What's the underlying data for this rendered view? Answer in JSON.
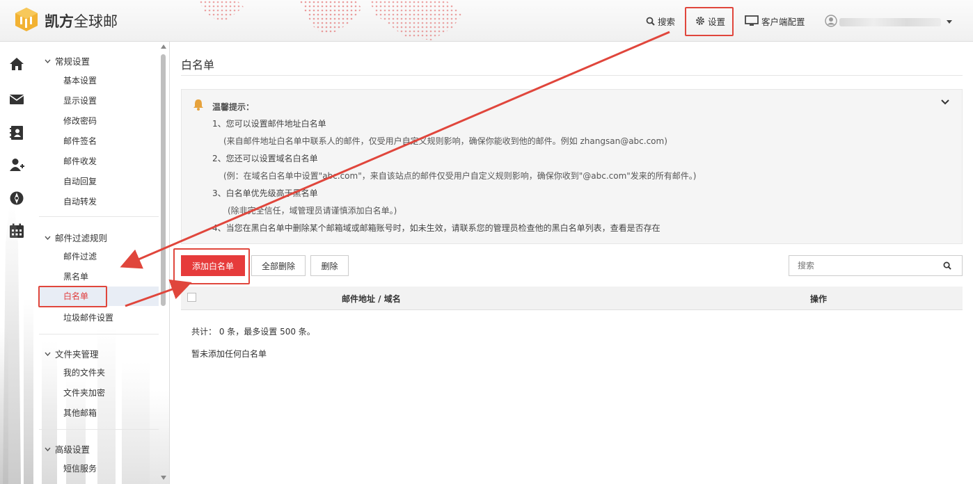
{
  "app": {
    "brand_bold": "凯方",
    "brand_rest": "全球邮"
  },
  "header": {
    "search_label": "搜索",
    "settings_label": "设置",
    "client_config_label": "客户端配置"
  },
  "sidebar": {
    "groups": [
      {
        "label": "常规设置",
        "items": [
          "基本设置",
          "显示设置",
          "修改密码",
          "邮件签名",
          "邮件收发",
          "自动回复",
          "自动转发"
        ]
      },
      {
        "label": "邮件过滤规则",
        "items": [
          "邮件过滤",
          "黑名单",
          "白名单",
          "垃圾邮件设置"
        ]
      },
      {
        "label": "文件夹管理",
        "items": [
          "我的文件夹",
          "文件夹加密",
          "其他邮箱"
        ]
      },
      {
        "label": "高级设置",
        "items": [
          "短信服务"
        ]
      }
    ],
    "active_item": "白名单"
  },
  "main": {
    "title": "白名单",
    "tips": {
      "title": "温馨提示：",
      "lines": [
        "1、您可以设置邮件地址白名单",
        "(来自邮件地址白名单中联系人的邮件，仅受用户自定义规则影响，确保你能收到他的邮件。例如 zhangsan@abc.com)",
        "2、您还可以设置域名白名单",
        "(例：在域名白名单中设置\"abc.com\"，来自该站点的邮件仅受用户自定义规则影响，确保你收到\"@abc.com\"发来的所有邮件。)",
        "3、白名单优先级高于黑名单",
        "(除非完全信任，域管理员请谨慎添加白名单。)",
        "4、当您在黑白名单中删除某个邮箱域或邮箱账号时，如未生效，请联系您的管理员检查他的黑白名单列表，查看是否存在"
      ]
    },
    "buttons": {
      "add": "添加白名单",
      "delete_all": "全部删除",
      "delete": "删除"
    },
    "search_placeholder": "搜索",
    "table": {
      "col_address": "邮件地址 / 域名",
      "col_action": "操作"
    },
    "summary": "共计： 0 条，最多设置 500 条。",
    "empty_text": "暂未添加任何白名单"
  },
  "colors": {
    "accent": "#e63b3b",
    "annotation": "#e0463c",
    "active_bg": "#e8edf5"
  },
  "icons": [
    "home-icon",
    "mail-icon",
    "contacts-icon",
    "add-user-icon",
    "compass-icon",
    "calendar-icon",
    "search-icon",
    "gear-icon",
    "monitor-icon",
    "avatar-icon",
    "bell-icon",
    "chevron-down-icon"
  ]
}
